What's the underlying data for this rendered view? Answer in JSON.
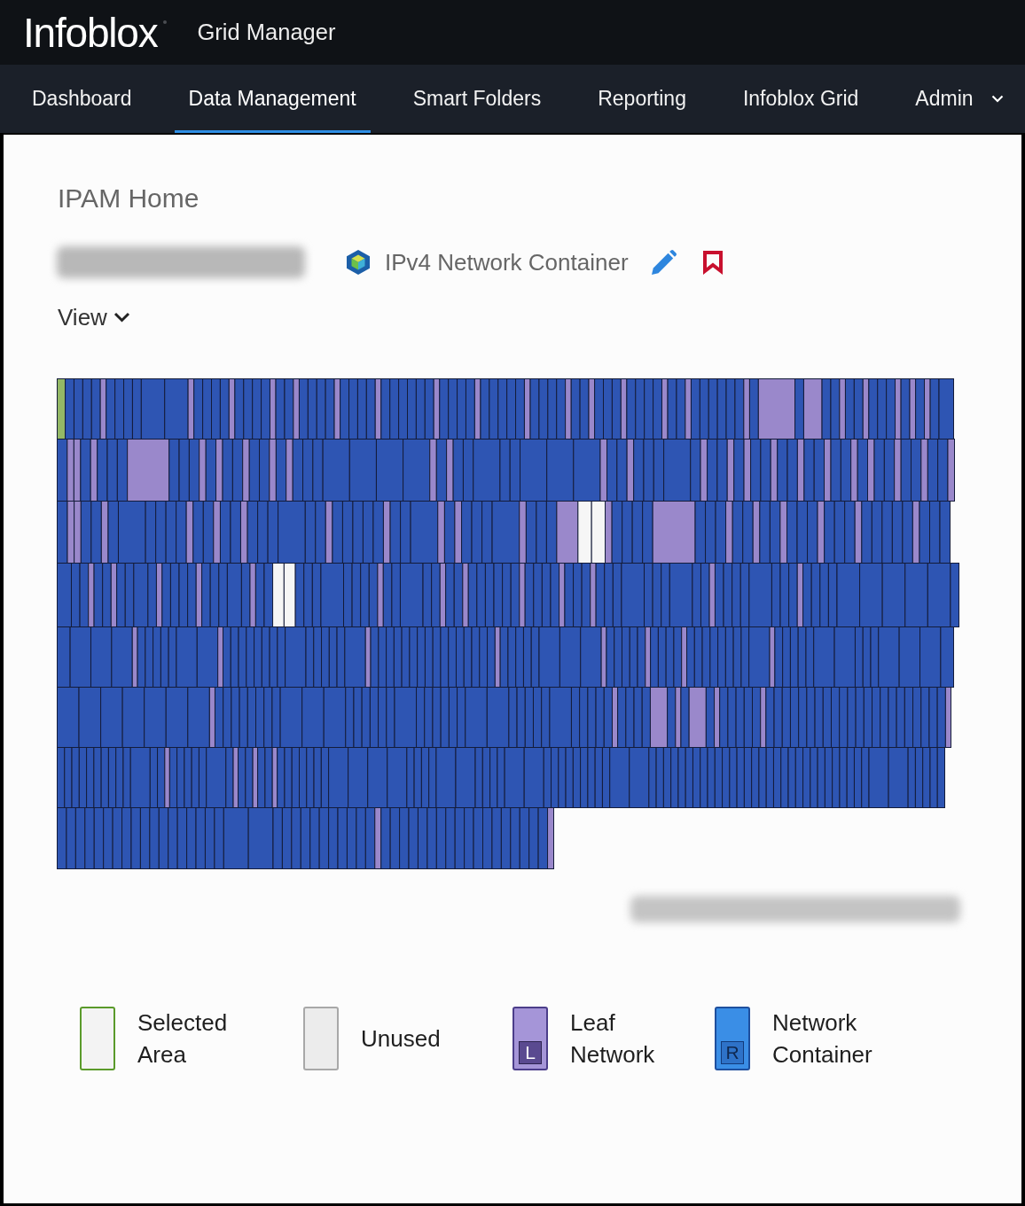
{
  "header": {
    "logo": "Infoblox",
    "product": "Grid Manager"
  },
  "nav": {
    "tabs": [
      {
        "label": "Dashboard",
        "selected": false,
        "menu": false
      },
      {
        "label": "Data Management",
        "selected": true,
        "menu": false
      },
      {
        "label": "Smart Folders",
        "selected": false,
        "menu": false
      },
      {
        "label": "Reporting",
        "selected": false,
        "menu": false
      },
      {
        "label": "Infoblox Grid",
        "selected": false,
        "menu": false
      },
      {
        "label": "Admin",
        "selected": false,
        "menu": true
      }
    ]
  },
  "page": {
    "breadcrumb": "IPAM Home",
    "network_address": {
      "redacted": true
    },
    "object_type": "IPv4 Network Container",
    "view_menu": "View",
    "address_range": {
      "redacted": true
    }
  },
  "legend": [
    {
      "kind": "selected",
      "label": "Selected Area"
    },
    {
      "kind": "unused",
      "label": "Unused"
    },
    {
      "kind": "leaf",
      "label": "Leaf Network",
      "badge": "L"
    },
    {
      "kind": "container",
      "label": "Network Container",
      "badge": "R"
    }
  ]
}
